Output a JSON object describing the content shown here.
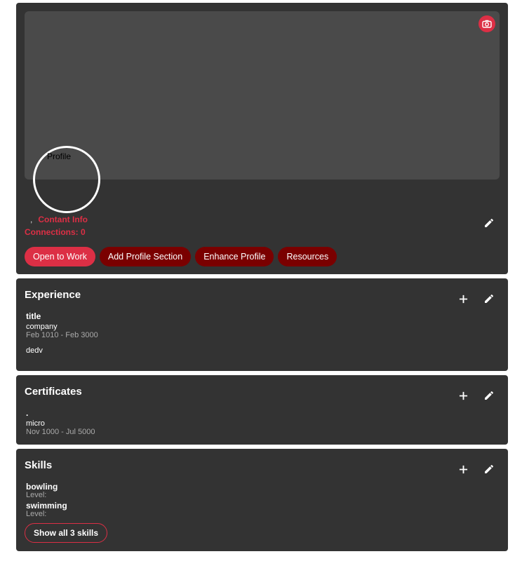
{
  "profile": {
    "avatar_alt": "Profile",
    "name": "",
    "headline_sep": ",",
    "contact_info": "Contant Info",
    "connections": "Connections: 0",
    "buttons": {
      "open_to_work": "Open to Work",
      "add_section": "Add Profile Section",
      "enhance": "Enhance Profile",
      "resources": "Resources"
    }
  },
  "experience": {
    "title": "Experience",
    "entry": {
      "title": "title",
      "company": "company",
      "dates": "Feb 1010 - Feb 3000",
      "description": "dedv"
    }
  },
  "certificates": {
    "title": "Certificates",
    "entry": {
      "title": ".",
      "issuer": "micro",
      "dates": "Nov 1000 - Jul 5000"
    }
  },
  "skills": {
    "title": "Skills",
    "items": [
      {
        "name": "bowling",
        "level": "Level:"
      },
      {
        "name": "swimming",
        "level": "Level:"
      }
    ],
    "show_all": "Show all 3 skills"
  },
  "colors": {
    "accent": "#dc2f45",
    "dark_accent": "#7a0000",
    "card": "#333333",
    "cover": "#4a4a4a"
  },
  "icons": {
    "camera": "camera-icon",
    "edit": "pencil-icon",
    "add": "plus-icon"
  }
}
